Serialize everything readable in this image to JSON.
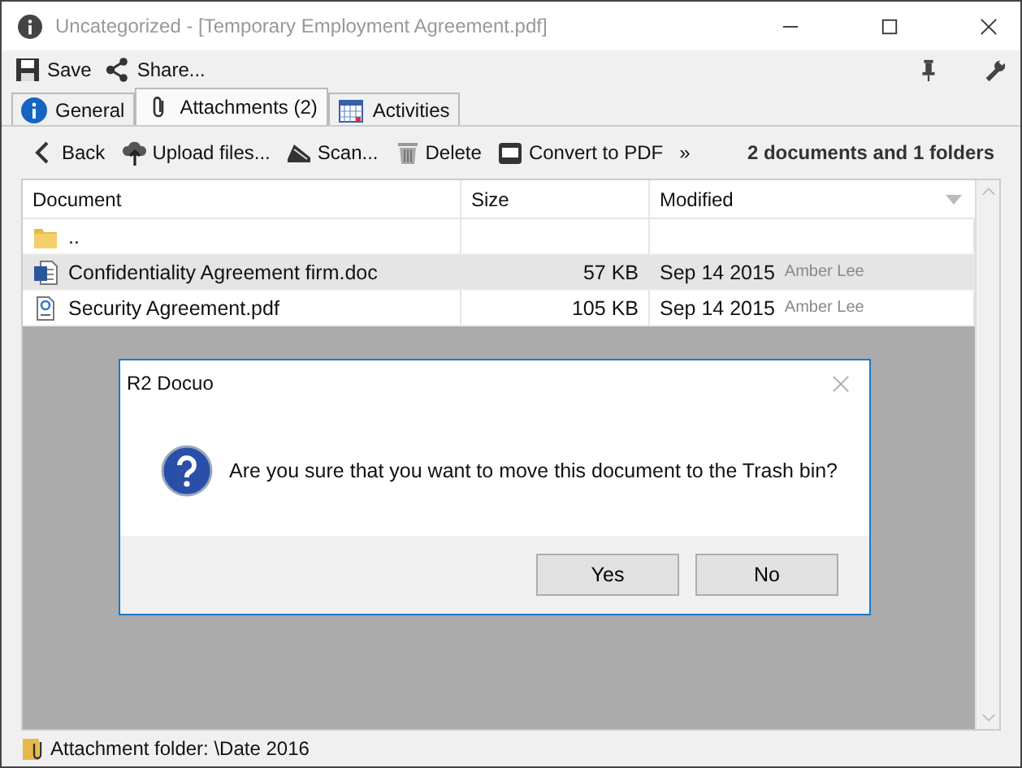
{
  "window": {
    "title": "Uncategorized - [Temporary Employment Agreement.pdf]"
  },
  "toolbar": {
    "save": "Save",
    "share": "Share..."
  },
  "tabs": [
    {
      "label": "General",
      "selected": false
    },
    {
      "label": "Attachments (2)",
      "selected": true
    },
    {
      "label": "Activities",
      "selected": false
    }
  ],
  "actions": [
    "Back",
    "Upload files...",
    "Scan...",
    "Delete",
    "Convert to PDF",
    "»"
  ],
  "summary": "2 documents and 1 folders",
  "table": {
    "columns": [
      "Document",
      "Size",
      "Modified"
    ],
    "rows": [
      {
        "kind": "folder",
        "name": "..",
        "selected": false
      },
      {
        "kind": "word",
        "name": "Confidentiality Agreement firm.doc",
        "size": "57 KB",
        "date": "Sep 14 2015",
        "author": "Amber Lee",
        "selected": true
      },
      {
        "kind": "pdf",
        "name": "Security Agreement.pdf",
        "size": "105 KB",
        "date": "Sep 14 2015",
        "author": "Amber Lee",
        "selected": false
      }
    ]
  },
  "dialog": {
    "title": "R2 Docuo",
    "message": "Are you sure that you want to move this document to the Trash bin?",
    "buttons": [
      "Yes",
      "No"
    ]
  },
  "status_bar": "Attachment folder: \\Date 2016"
}
